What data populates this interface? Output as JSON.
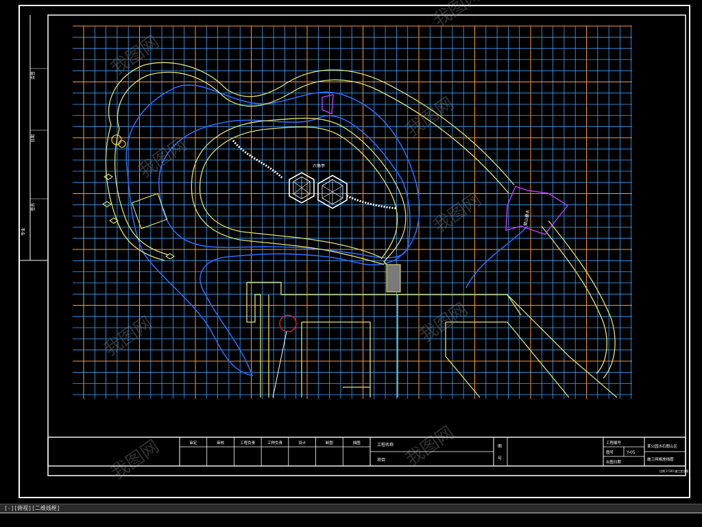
{
  "colors": {
    "background": "#000000",
    "frame": "#ffffff",
    "grid_blue": "#3aa8ff",
    "grid_orange": "#ff9a2e",
    "path_yellow": "#e6e46a",
    "water_blue": "#2a6cff",
    "pavilion_white": "#ffffff",
    "rock_magenta": "#c040ff",
    "entrance_red": "#e02020",
    "watermark": "#8a8a8a"
  },
  "drawing": {
    "watermark_text": "我图网",
    "title_block": {
      "headers": [
        "审定",
        "审核",
        "工程负责",
        "工种负责",
        "设计",
        "制图",
        "描图"
      ],
      "project_label": "工程名称",
      "item_label": "项目",
      "stamp_label": "图",
      "stamp_label2": "号",
      "project_no_label": "工程编号",
      "drawing_no_label": "图号",
      "drawing_no_value": "Y-05",
      "date_label": "出图日期",
      "title_line1": "某公园水石假山区",
      "title_line2": "施工网格放线图",
      "footnote": "比例 1:500 施工定位图"
    },
    "left_strip": [
      "会签",
      "日期",
      "签名",
      "专业"
    ],
    "pavilion_label": "六角亭",
    "rock_label": "假山叠水"
  },
  "icons": {
    "pavilion": "hexagon-pavilion-icon",
    "entrance": "circle-marker-icon"
  },
  "command_bar": {
    "text": "[-][俯视][二维线框]"
  }
}
